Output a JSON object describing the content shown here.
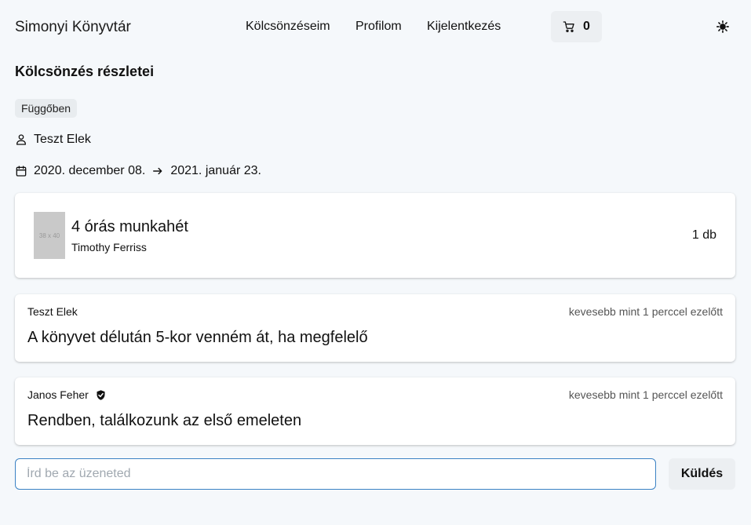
{
  "nav": {
    "brand": "Simonyi Könyvtár",
    "links": [
      "Kölcsönzéseim",
      "Profilom",
      "Kijelentkezés"
    ],
    "cart_count": "0",
    "cart_icon": "cart-icon",
    "theme_icon": "sun-icon"
  },
  "page": {
    "title": "Kölcsönzés részletei",
    "status": "Függőben",
    "user": "Teszt Elek",
    "date_from": "2020. december 08.",
    "date_to": "2021. január 23."
  },
  "book": {
    "title": "4 órás munkahét",
    "author": "Timothy Ferriss",
    "quantity": "1 db",
    "thumbnail_text": "38 x 40"
  },
  "messages": [
    {
      "author": "Teszt Elek",
      "verified": false,
      "time": "kevesebb mint 1 perccel ezelőtt",
      "text": "A könyvet délután 5-kor venném át, ha megfelelő"
    },
    {
      "author": "Janos Feher",
      "verified": true,
      "time": "kevesebb mint 1 perccel ezelőtt",
      "text": "Rendben, találkozunk az első emeleten"
    }
  ],
  "composer": {
    "placeholder": "Írd be az üzeneted",
    "value": "",
    "send_label": "Küldés"
  },
  "colors": {
    "background": "#f5f8fb",
    "input_border": "#3b82c4",
    "button_bg": "#eceff2"
  }
}
